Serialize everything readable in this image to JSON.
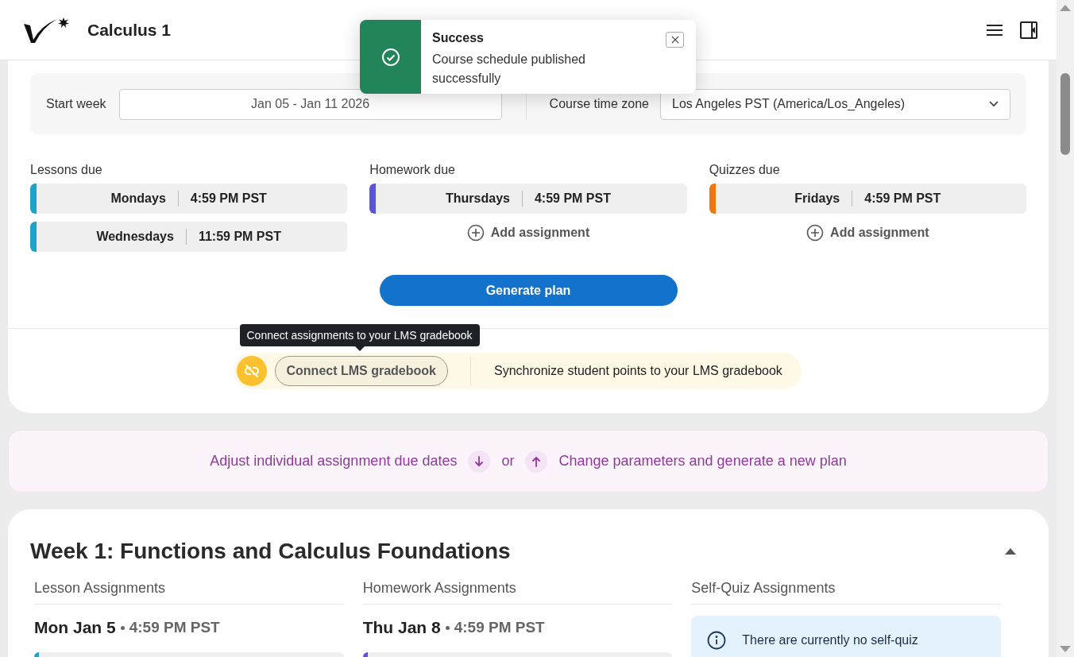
{
  "header": {
    "title": "Calculus 1"
  },
  "toast": {
    "title": "Success",
    "message": "Course schedule published successfully"
  },
  "settings": {
    "start_week": {
      "label": "Start week",
      "value": "Jan 05 - Jan 11 2026"
    },
    "time_zone": {
      "label": "Course time zone",
      "value": "Los Angeles PST (America/Los_Angeles)"
    }
  },
  "due_columns": [
    {
      "label": "Lessons due",
      "color": "#1ba3cc",
      "slots": [
        {
          "day": "Mondays",
          "time": "4:59 PM PST"
        },
        {
          "day": "Wednesdays",
          "time": "11:59 PM PST"
        }
      ]
    },
    {
      "label": "Homework due",
      "color": "#5b55d6",
      "slots": [
        {
          "day": "Thursdays",
          "time": "4:59 PM PST"
        }
      ],
      "add_label": "Add assignment"
    },
    {
      "label": "Quizzes due",
      "color": "#f2760f",
      "slots": [
        {
          "day": "Fridays",
          "time": "4:59 PM PST"
        }
      ],
      "add_label": "Add assignment"
    }
  ],
  "generate_button": "Generate plan",
  "lms": {
    "tooltip": "Connect assignments to your LMS gradebook",
    "button": "Connect LMS gradebook",
    "description": "Synchronize student points to your LMS gradebook"
  },
  "banner": {
    "left": "Adjust individual assignment due dates",
    "or": "or",
    "right": "Change parameters and generate a new plan"
  },
  "week": {
    "title": "Week 1: Functions and Calculus Foundations",
    "expanded": true,
    "columns": [
      {
        "heading": "Lesson Assignments",
        "date": "Mon Jan 5",
        "time": "4:59 PM PST",
        "color": "#1ba3cc"
      },
      {
        "heading": "Homework Assignments",
        "date": "Thu Jan 8",
        "time": "4:59 PM PST",
        "color": "#5b55d6"
      },
      {
        "heading": "Self-Quiz Assignments",
        "notice": "There are currently no self-quiz"
      }
    ]
  }
}
